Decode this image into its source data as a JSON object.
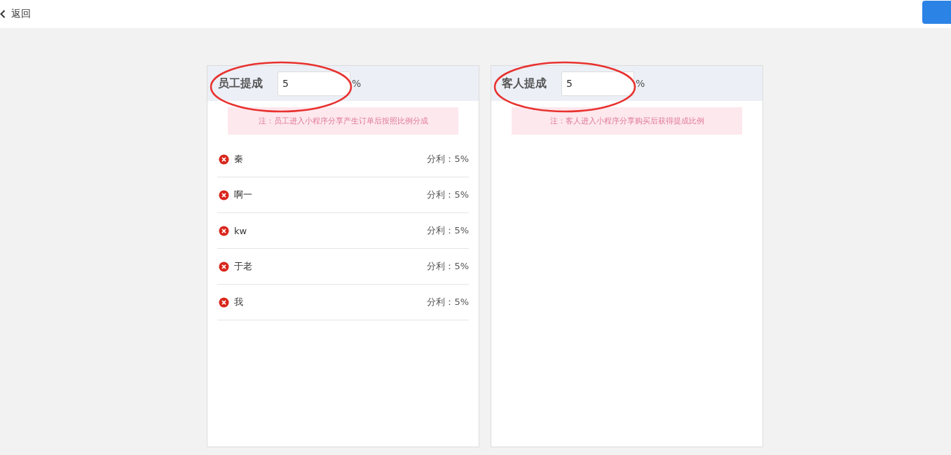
{
  "top_bar": {
    "back_label": "返回"
  },
  "panels": [
    {
      "title": "员工提成",
      "value": "5",
      "unit": "%",
      "circled": true,
      "note": "注：员工进入小程序分享产生订单后按照比例分成",
      "members": [
        {
          "name": "秦",
          "share": "分利：5%"
        },
        {
          "name": "啊一",
          "share": "分利：5%"
        },
        {
          "name": "kw",
          "share": "分利：5%"
        },
        {
          "name": "于老",
          "share": "分利：5%"
        },
        {
          "name": "我",
          "share": "分利：5%"
        }
      ]
    },
    {
      "title": "客人提成",
      "value": "5",
      "unit": "%",
      "circled": true,
      "note": "注：客人进入小程序分享购买后获得提成比例"
    }
  ]
}
